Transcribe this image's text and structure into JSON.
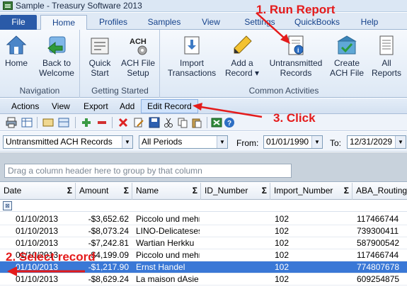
{
  "window": {
    "title": "Sample - Treasury Software 2013"
  },
  "ribbon_tabs": [
    "File",
    "Home",
    "Profiles",
    "Samples",
    "View",
    "Settings",
    "QuickBooks",
    "Help"
  ],
  "ribbon": {
    "navigation": {
      "label": "Navigation",
      "home": "Home",
      "back1": "Back to",
      "back2": "Welcome"
    },
    "getting_started": {
      "label": "Getting Started",
      "quick1": "Quick",
      "quick2": "Start",
      "ach1": "ACH File",
      "ach2": "Setup"
    },
    "common": {
      "label": "Common Activities",
      "import1": "Import",
      "import2": "Transactions",
      "add1": "Add a",
      "add2": "Record ▾",
      "untrans1": "Untransmitted",
      "untrans2": "Records",
      "create1": "Create",
      "create2": "ACH File",
      "all1": "All",
      "all2": "Reports"
    }
  },
  "menubar": [
    "Actions",
    "View",
    "Export",
    "Add",
    "Edit Record"
  ],
  "filter": {
    "view": "Untransmitted ACH Records",
    "period": "All Periods",
    "from_label": "From:",
    "from_value": "01/01/1990",
    "to_label": "To:",
    "to_value": "12/31/2029"
  },
  "group_hint": "Drag a column header here to group by that column",
  "grid": {
    "columns": [
      "Date",
      "Amount",
      "Name",
      "ID_Number",
      "Import_Number",
      "ABA_Routing_"
    ],
    "rows": [
      {
        "date": "01/10/2013",
        "amount": "-$3,652.62",
        "name": "Piccolo und mehr",
        "id": "",
        "imp": "102",
        "aba": "117466744",
        "selected": false
      },
      {
        "date": "01/10/2013",
        "amount": "-$8,073.24",
        "name": "LINO-Delicateses",
        "id": "",
        "imp": "102",
        "aba": "739300411",
        "selected": false
      },
      {
        "date": "01/10/2013",
        "amount": "-$7,242.81",
        "name": "Wartian Herkku",
        "id": "",
        "imp": "102",
        "aba": "587900542",
        "selected": false
      },
      {
        "date": "01/10/2013",
        "amount": "-$4,199.09",
        "name": "Piccolo und mehr",
        "id": "",
        "imp": "102",
        "aba": "117466744",
        "selected": false
      },
      {
        "date": "01/10/2013",
        "amount": "-$1,217.90",
        "name": "Ernst Handel",
        "id": "",
        "imp": "102",
        "aba": "774807678",
        "selected": true
      },
      {
        "date": "01/10/2013",
        "amount": "-$8,629.24",
        "name": "La maison dAsie",
        "id": "",
        "imp": "102",
        "aba": "609254875",
        "selected": false
      }
    ]
  },
  "annotations": {
    "step1": "1. Run Report",
    "step2": "2. Select record",
    "step3": "3. Click",
    "color": "#e41b1b"
  }
}
